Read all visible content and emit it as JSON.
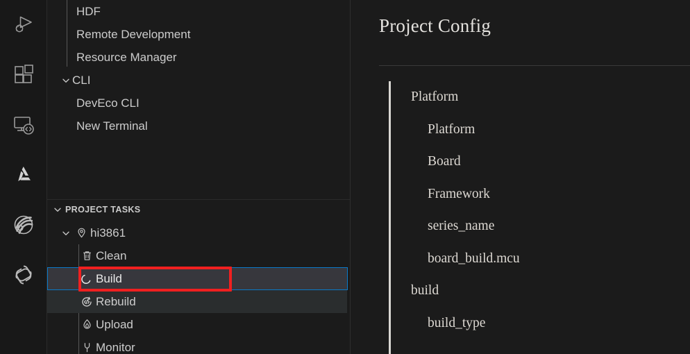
{
  "activity_bar": {
    "items": [
      {
        "name": "run-and-debug-icon",
        "label": "Run and Debug"
      },
      {
        "name": "extensions-icon",
        "label": "Extensions"
      },
      {
        "name": "remote-explorer-icon",
        "label": "Remote Explorer"
      },
      {
        "name": "deveco-device-tool-icon",
        "label": "DevEco Device Tool"
      },
      {
        "name": "openharmony-icon",
        "label": "OpenHarmony"
      },
      {
        "name": "openai-icon",
        "label": "OpenAI"
      }
    ]
  },
  "sidebar": {
    "top_tree": [
      {
        "label": "HDF",
        "indent": 2,
        "twisty": "",
        "icon": ""
      },
      {
        "label": "Remote Development",
        "indent": 2,
        "twisty": "",
        "icon": ""
      },
      {
        "label": "Resource Manager",
        "indent": 2,
        "twisty": "",
        "icon": ""
      },
      {
        "label": "CLI",
        "indent": 1,
        "twisty": "chevron-down",
        "icon": ""
      },
      {
        "label": "DevEco CLI",
        "indent": 2,
        "twisty": "",
        "icon": ""
      },
      {
        "label": "New Terminal",
        "indent": 2,
        "twisty": "",
        "icon": ""
      }
    ],
    "section": {
      "title": "PROJECT TASKS",
      "twisty": "chevron-down"
    },
    "task_tree": [
      {
        "label": "hi3861",
        "indent": 1,
        "twisty": "chevron-down",
        "icon": "location-pin-icon",
        "state": "normal"
      },
      {
        "label": "Clean",
        "indent": 2,
        "twisty": "",
        "icon": "trash-icon",
        "state": "normal"
      },
      {
        "label": "Build",
        "indent": 2,
        "twisty": "",
        "icon": "build-crescent-icon",
        "state": "selected"
      },
      {
        "label": "Rebuild",
        "indent": 2,
        "twisty": "",
        "icon": "rebuild-code-icon",
        "state": "hovered"
      },
      {
        "label": "Upload",
        "indent": 2,
        "twisty": "",
        "icon": "flame-upload-icon",
        "state": "normal"
      },
      {
        "label": "Monitor",
        "indent": 2,
        "twisty": "",
        "icon": "plug-monitor-icon",
        "state": "normal"
      }
    ],
    "annotation": {
      "name": "red-highlight-box",
      "color": "#f02020",
      "target_label": "Build"
    },
    "colors": {
      "selection_border": "#0a7aca",
      "selection_background": "#37373d",
      "hover_background": "#2a2d2e",
      "background": "#1b1b1b",
      "text": "#cccccc"
    }
  },
  "right_panel": {
    "title": "Project Config",
    "items": [
      {
        "label": "Platform",
        "level": 1
      },
      {
        "label": "Platform",
        "level": 2
      },
      {
        "label": "Board",
        "level": 2
      },
      {
        "label": "Framework",
        "level": 2
      },
      {
        "label": "series_name",
        "level": 2
      },
      {
        "label": "board_build.mcu",
        "level": 2
      },
      {
        "label": "build",
        "level": 1
      },
      {
        "label": "build_type",
        "level": 2
      }
    ]
  }
}
